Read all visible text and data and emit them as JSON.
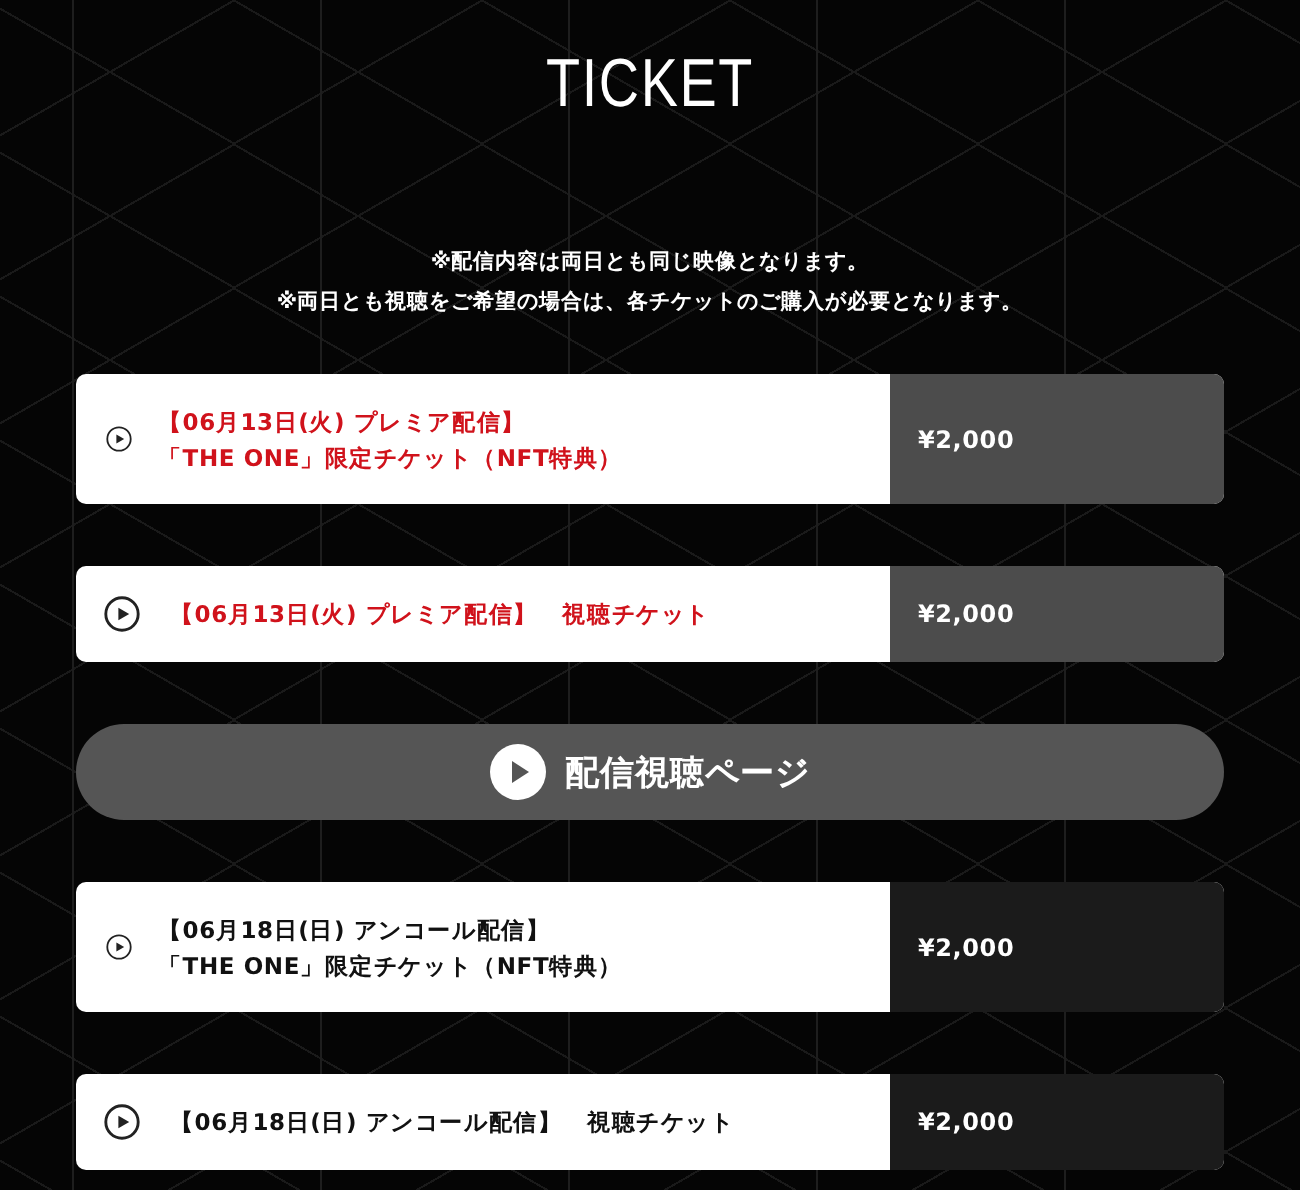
{
  "title": "TICKET",
  "notes": [
    "※配信内容は両日とも同じ映像となります。",
    "※両日とも視聴をご希望の場合は、各チケットのご購入が必要となります。"
  ],
  "tickets": [
    {
      "kind": "premiere",
      "lines": [
        "【06月13日(火) プレミア配信】",
        "「THE ONE」限定チケット（NFT特典）"
      ],
      "price": "¥2,000"
    },
    {
      "kind": "premiere",
      "lines": [
        "【06月13日(火) プレミア配信】　視聴チケット"
      ],
      "price": "¥2,000"
    },
    {
      "kind": "watch_button",
      "label": "配信視聴ページ"
    },
    {
      "kind": "encore",
      "lines": [
        "【06月18日(日) アンコール配信】",
        "「THE ONE」限定チケット（NFT特典）"
      ],
      "price": "¥2,000"
    },
    {
      "kind": "encore",
      "lines": [
        "【06月18日(日) アンコール配信】　視聴チケット"
      ],
      "price": "¥2,000"
    }
  ]
}
